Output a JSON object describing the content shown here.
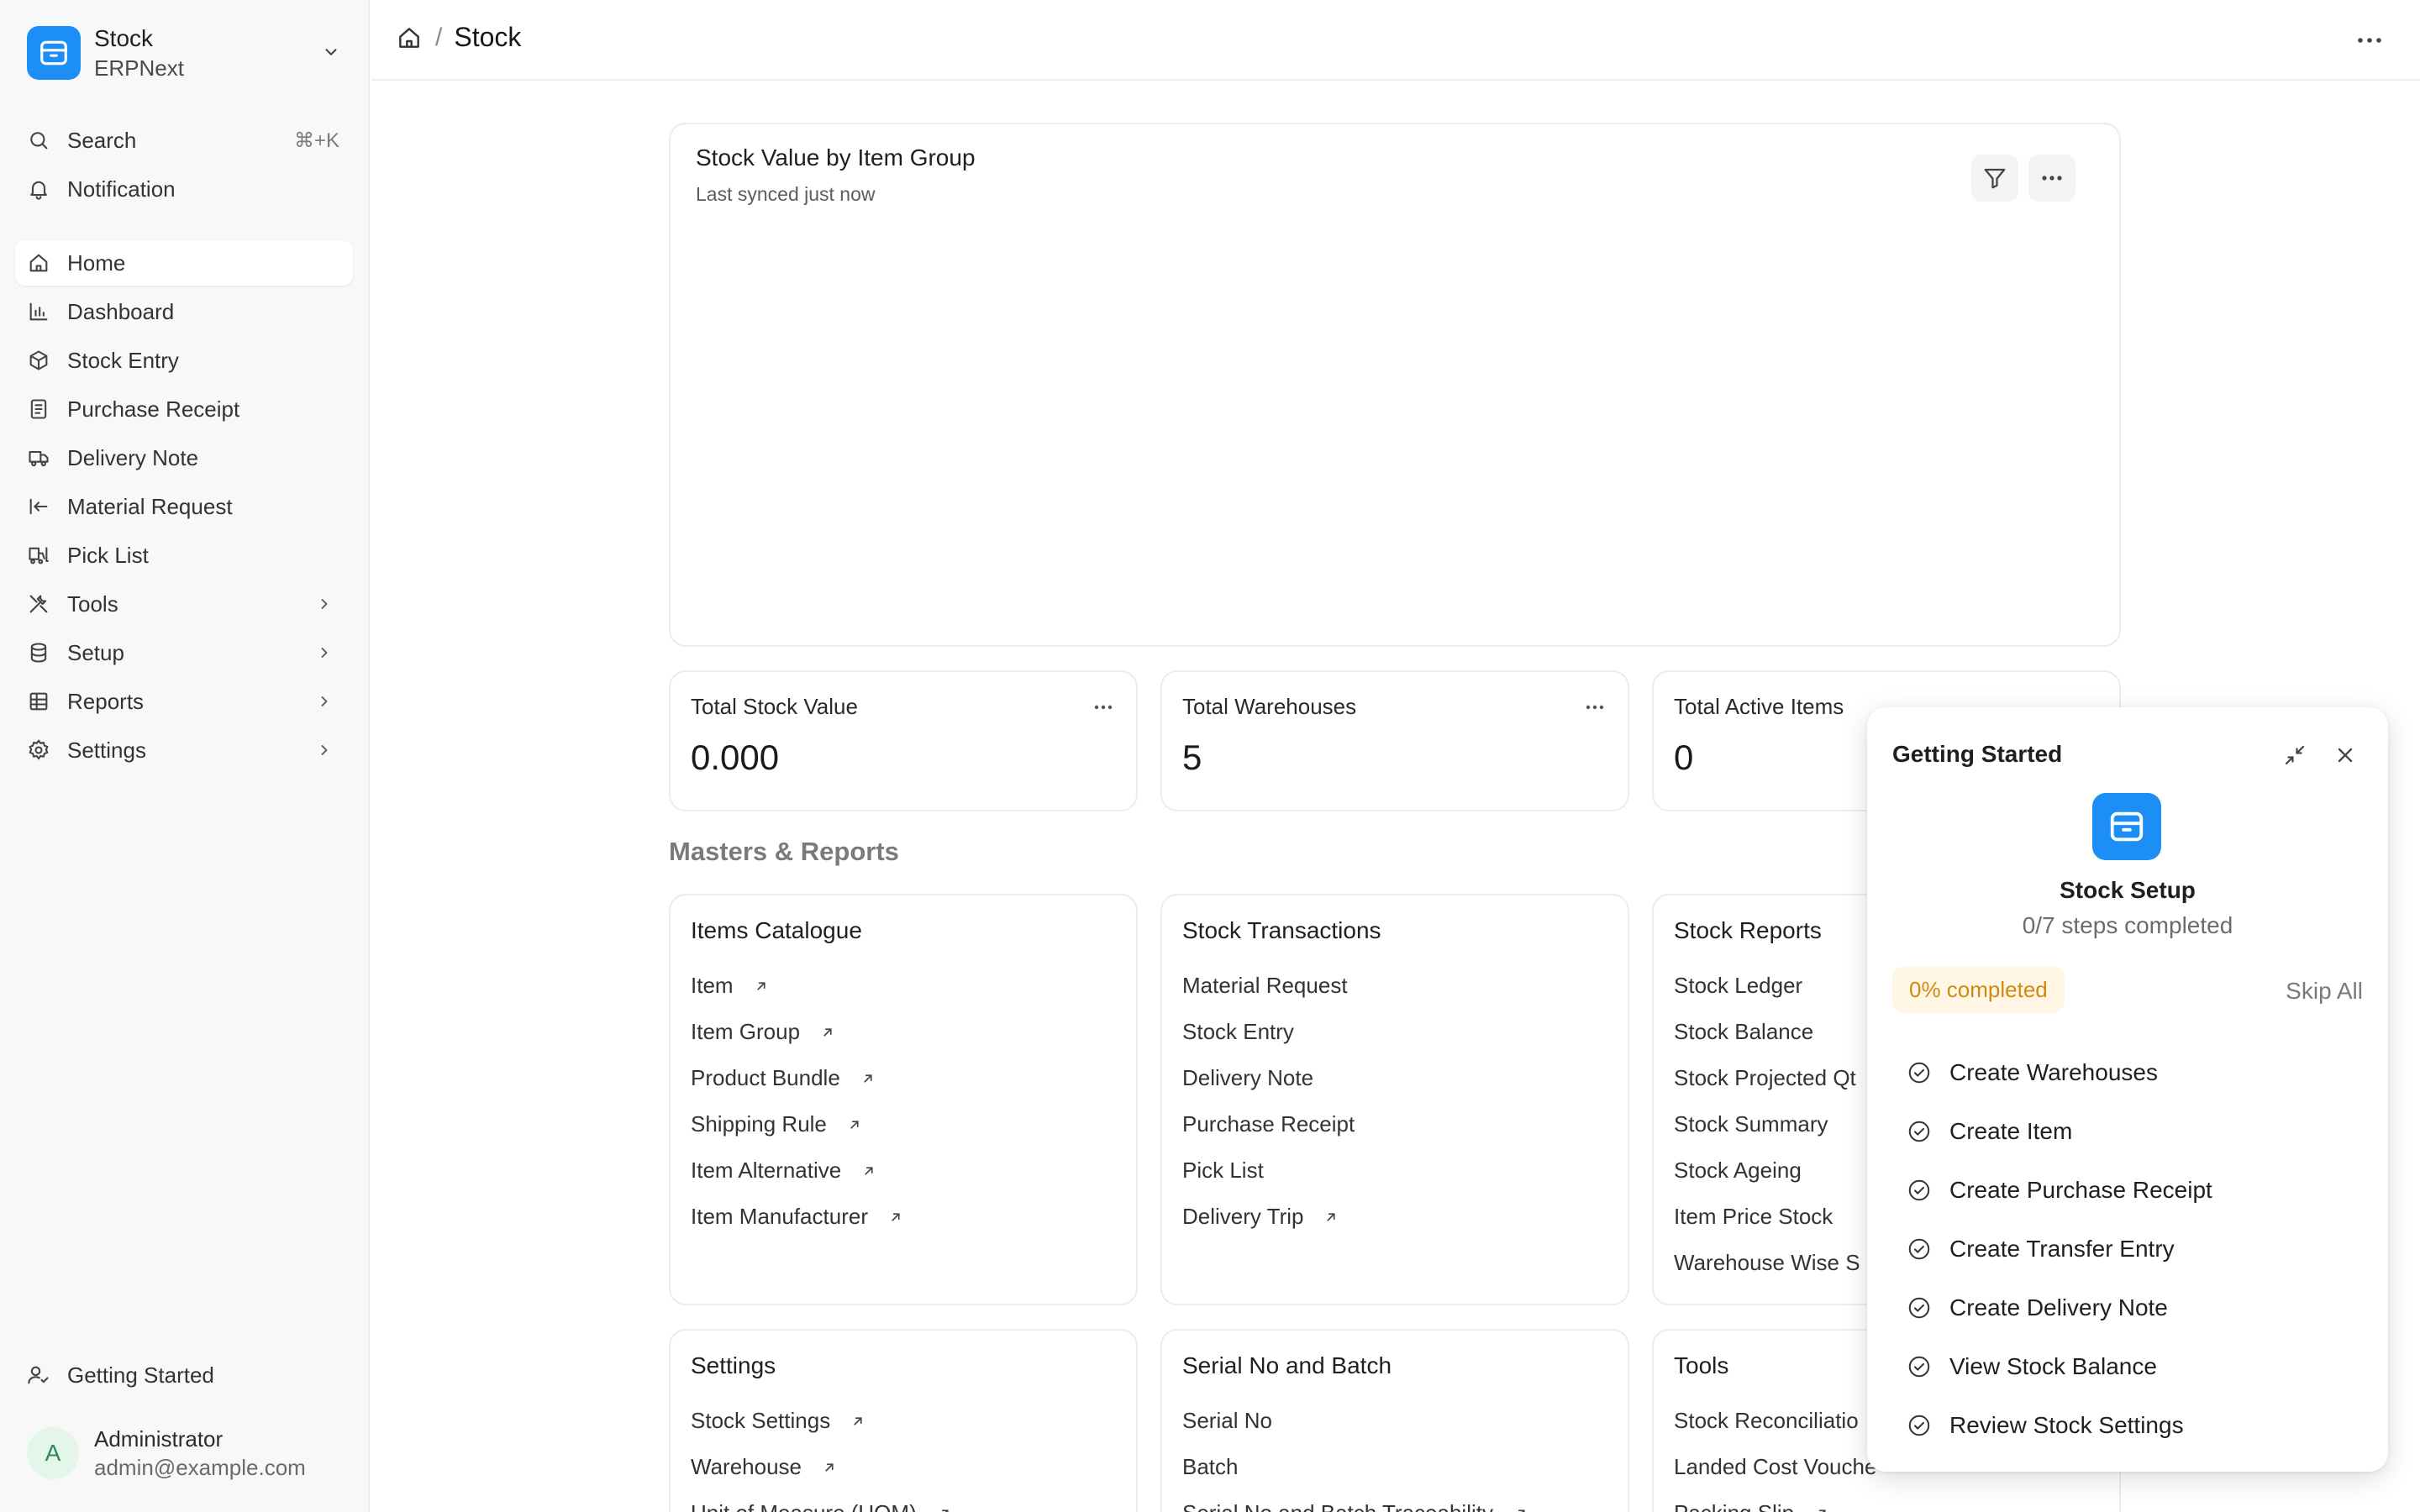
{
  "app": {
    "name": "Stock",
    "subtitle": "ERPNext",
    "accent": "#1d8ef5"
  },
  "sidebar": {
    "search": {
      "label": "Search",
      "shortcut": "⌘+K"
    },
    "notification": {
      "label": "Notification"
    },
    "items": [
      {
        "label": "Home",
        "icon": "home-icon",
        "active": true
      },
      {
        "label": "Dashboard",
        "icon": "bar-chart-icon"
      },
      {
        "label": "Stock Entry",
        "icon": "box-icon"
      },
      {
        "label": "Purchase Receipt",
        "icon": "receipt-icon"
      },
      {
        "label": "Delivery Note",
        "icon": "truck-icon"
      },
      {
        "label": "Material Request",
        "icon": "arrow-left-bar-icon"
      },
      {
        "label": "Pick List",
        "icon": "forklift-icon"
      },
      {
        "label": "Tools",
        "icon": "tools-icon",
        "expandable": true
      },
      {
        "label": "Setup",
        "icon": "database-icon",
        "expandable": true
      },
      {
        "label": "Reports",
        "icon": "table-icon",
        "expandable": true
      },
      {
        "label": "Settings",
        "icon": "gear-icon",
        "expandable": true
      }
    ],
    "getting_started": "Getting Started",
    "user": {
      "initial": "A",
      "name": "Administrator",
      "email": "admin@example.com"
    }
  },
  "topbar": {
    "breadcrumb_sep": "/",
    "current": "Stock"
  },
  "chart_card": {
    "title": "Stock Value by Item Group",
    "subtitle": "Last synced just now"
  },
  "number_cards": [
    {
      "label": "Total Stock Value",
      "value": "0.000"
    },
    {
      "label": "Total Warehouses",
      "value": "5"
    },
    {
      "label": "Total Active Items",
      "value": "0"
    }
  ],
  "masters_title": "Masters & Reports",
  "link_cards": [
    {
      "title": "Items Catalogue",
      "links": [
        {
          "label": "Item",
          "external": true
        },
        {
          "label": "Item Group",
          "external": true
        },
        {
          "label": "Product Bundle",
          "external": true
        },
        {
          "label": "Shipping Rule",
          "external": true
        },
        {
          "label": "Item Alternative",
          "external": true
        },
        {
          "label": "Item Manufacturer",
          "external": true
        }
      ]
    },
    {
      "title": "Stock Transactions",
      "links": [
        {
          "label": "Material Request",
          "external": false
        },
        {
          "label": "Stock Entry",
          "external": false
        },
        {
          "label": "Delivery Note",
          "external": false
        },
        {
          "label": "Purchase Receipt",
          "external": false
        },
        {
          "label": "Pick List",
          "external": false
        },
        {
          "label": "Delivery Trip",
          "external": true
        }
      ]
    },
    {
      "title": "Stock Reports",
      "links": [
        {
          "label": "Stock Ledger",
          "external": false
        },
        {
          "label": "Stock Balance",
          "external": false
        },
        {
          "label": "Stock Projected Qt",
          "external": false
        },
        {
          "label": "Stock Summary",
          "external": false
        },
        {
          "label": "Stock Ageing",
          "external": false
        },
        {
          "label": "Item Price Stock",
          "external": false
        },
        {
          "label": "Warehouse Wise S",
          "external": false
        }
      ]
    },
    {
      "title": "Settings",
      "links": [
        {
          "label": "Stock Settings",
          "external": true
        },
        {
          "label": "Warehouse",
          "external": true
        },
        {
          "label": "Unit of Measure (UOM)",
          "external": true
        }
      ]
    },
    {
      "title": "Serial No and Batch",
      "links": [
        {
          "label": "Serial No",
          "external": false
        },
        {
          "label": "Batch",
          "external": false
        },
        {
          "label": "Serial No and Batch Traceability",
          "external": true
        }
      ]
    },
    {
      "title": "Tools",
      "links": [
        {
          "label": "Stock Reconciliatio",
          "external": false
        },
        {
          "label": "Landed Cost Vouche",
          "external": true
        },
        {
          "label": "Packing Slip",
          "external": true
        }
      ]
    }
  ],
  "getting_started": {
    "title": "Getting Started",
    "setup_title": "Stock Setup",
    "steps_completed": "0/7 steps completed",
    "progress_label": "0% completed",
    "progress_color": "#d18a10",
    "skip_all": "Skip All",
    "steps": [
      "Create Warehouses",
      "Create Item",
      "Create Purchase Receipt",
      "Create Transfer Entry",
      "Create Delivery Note",
      "View Stock Balance",
      "Review Stock Settings"
    ]
  }
}
